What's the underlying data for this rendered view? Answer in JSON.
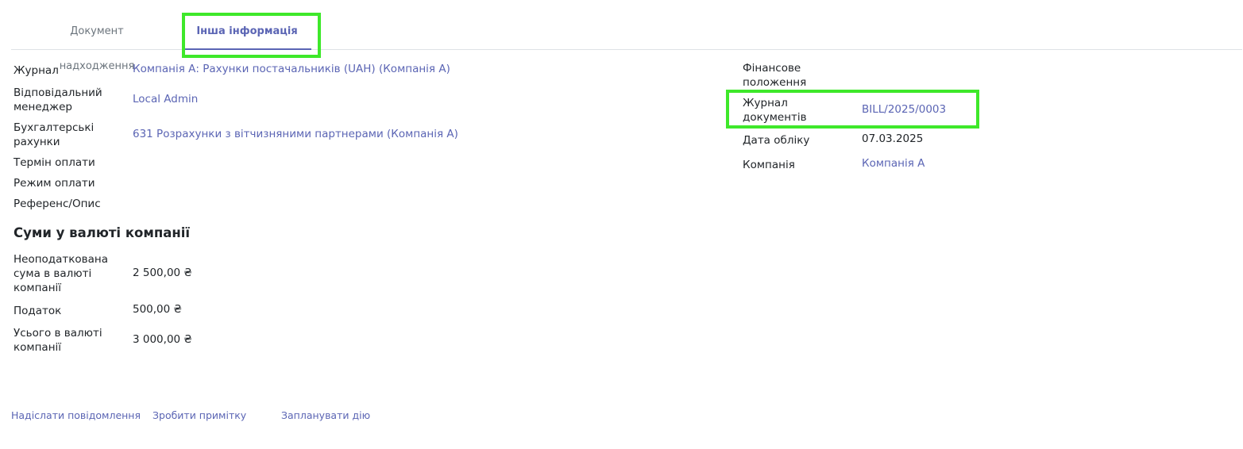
{
  "tabs": [
    {
      "label": "Документ надходження"
    },
    {
      "label": "Інша інформація"
    }
  ],
  "left_fields": {
    "journal": {
      "label": "Журнал",
      "value": "Компанія А: Рахунки постачальників (UAH) (Компанія А)"
    },
    "manager": {
      "label_line1": "Відповідальний",
      "label_line2": "менеджер",
      "value": "Local Admin"
    },
    "accounts": {
      "label_line1": "Бухгалтерські",
      "label_line2": "рахунки",
      "value": "631 Розрахунки з вітчизняними партнерами (Компанія А)"
    },
    "payment_term": {
      "label": "Термін оплати",
      "value": ""
    },
    "payment_mode": {
      "label": "Режим оплати",
      "value": ""
    },
    "reference": {
      "label": "Референс/Опис",
      "value": ""
    }
  },
  "right_fields": {
    "fiscal_position": {
      "label_line1": "Фінансове",
      "label_line2": "положення",
      "value": ""
    },
    "doc_journal": {
      "label_line1": "Журнал",
      "label_line2": "документів",
      "value": "BILL/2025/0003"
    },
    "accounting_date": {
      "label": "Дата обліку",
      "value": "07.03.2025"
    },
    "company": {
      "label": "Компанія",
      "value": "Компанія А"
    }
  },
  "amounts": {
    "title": "Суми у валюті компанії",
    "untaxed": {
      "label_line1": "Неоподаткована",
      "label_line2": "сума в валюті",
      "label_line3": "компанії",
      "value": "2 500,00 ₴"
    },
    "tax": {
      "label": "Податок",
      "value": "500,00 ₴"
    },
    "total": {
      "label_line1": "Усього в валюті",
      "label_line2": "компанії",
      "value": "3 000,00 ₴"
    }
  },
  "footer": {
    "send_message": "Надіслати повідомлення",
    "log_note": "Зробити примітку",
    "schedule_activity": "Запланувати дію"
  },
  "colors": {
    "accent": "#5b65b4",
    "highlight": "#3ee82a",
    "text": "#212529",
    "muted": "#6c757d"
  }
}
